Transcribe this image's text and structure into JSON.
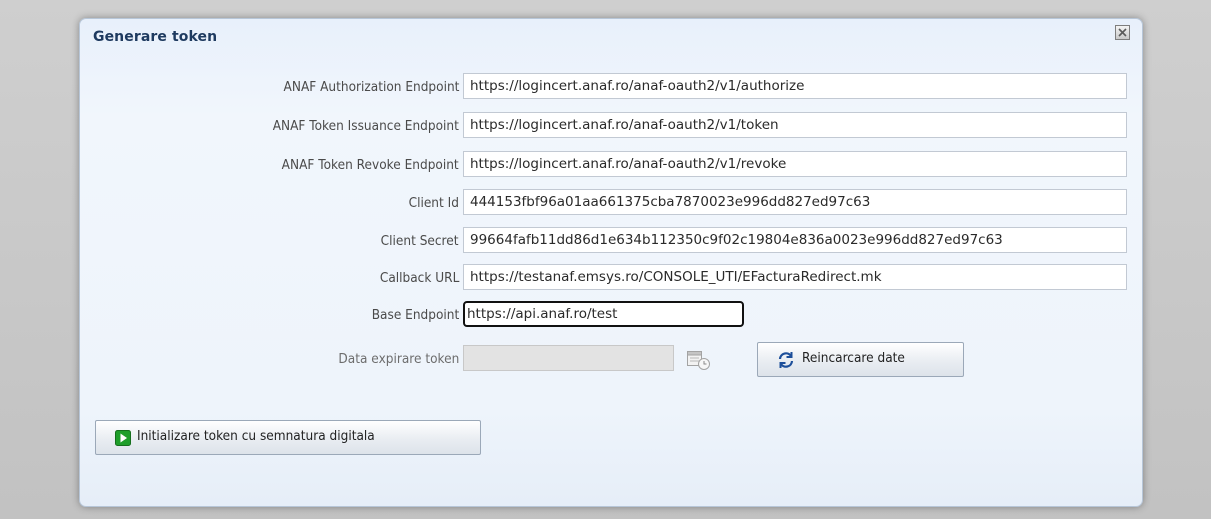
{
  "dialog": {
    "title": "Generare token"
  },
  "fields": [
    {
      "label": "ANAF Authorization Endpoint",
      "value": "https://logincert.anaf.ro/anaf-oauth2/v1/authorize"
    },
    {
      "label": "ANAF Token Issuance Endpoint",
      "value": "https://logincert.anaf.ro/anaf-oauth2/v1/token"
    },
    {
      "label": "ANAF Token Revoke Endpoint",
      "value": "https://logincert.anaf.ro/anaf-oauth2/v1/revoke"
    },
    {
      "label": "Client Id",
      "value": "444153fbf96a01aa661375cba7870023e996dd827ed97c63"
    },
    {
      "label": "Client Secret",
      "value": "99664fafb11dd86d1e634b112350c9f02c19804e836a0023e996dd827ed97c63"
    },
    {
      "label": "Callback URL",
      "value": "https://testanaf.emsys.ro/CONSOLE_UTI/EFacturaRedirect.mk"
    },
    {
      "label": "Base Endpoint",
      "value": "https://api.anaf.ro/test"
    }
  ],
  "expiry": {
    "label": "Data expirare token",
    "value": ""
  },
  "buttons": {
    "reload_label": "Reincarcare date",
    "init_label": "Initializare token cu semnatura digitala"
  },
  "icons": {
    "close": "close-icon",
    "calendar": "calendar-clock-icon",
    "reload": "refresh-icon",
    "init": "green-play-icon"
  },
  "colors": {
    "title": "#1e3a5f",
    "dialog_bg": "#eef4fb",
    "focus_border": "#111111",
    "play_green": "#1f9e2a",
    "refresh_blue": "#1d4f9a"
  }
}
